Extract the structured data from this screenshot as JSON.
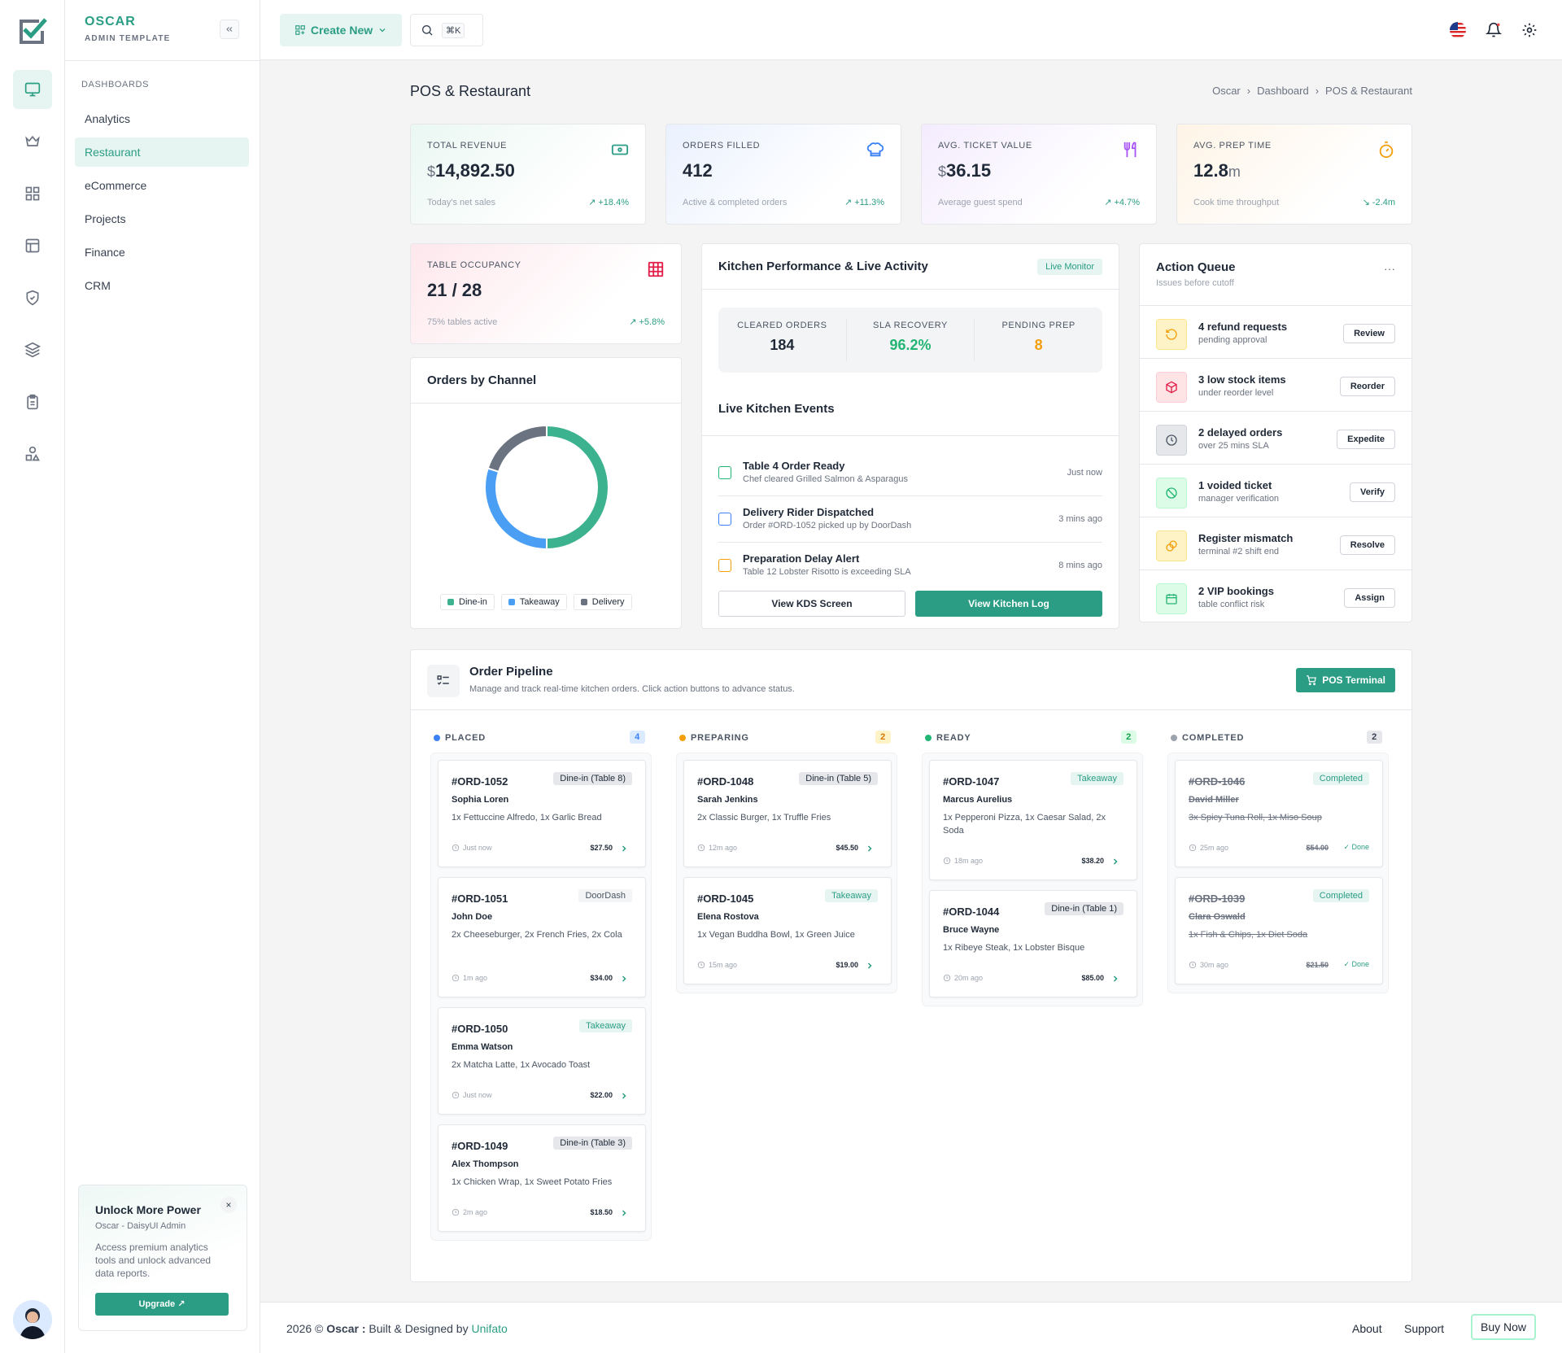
{
  "brand": {
    "name": "OSCAR",
    "tagline": "ADMIN TEMPLATE"
  },
  "rail": {
    "icons": [
      "monitor-icon",
      "crown-icon",
      "grid-icon",
      "layout-icon",
      "shield-icon",
      "layers-icon",
      "clipboard-icon",
      "shapes-icon"
    ]
  },
  "sidebar": {
    "section": "DASHBOARDS",
    "items": [
      {
        "label": "Analytics"
      },
      {
        "label": "Restaurant"
      },
      {
        "label": "eCommerce"
      },
      {
        "label": "Projects"
      },
      {
        "label": "Finance"
      },
      {
        "label": "CRM"
      }
    ]
  },
  "promo": {
    "title": "Unlock More Power",
    "subtitle": "Oscar - DaisyUI Admin",
    "desc": "Access premium analytics tools and unlock advanced data reports.",
    "button": "Upgrade",
    "close": "×"
  },
  "topbar": {
    "create_new": "Create New",
    "shortcut": "⌘K"
  },
  "page": {
    "title": "POS & Restaurant",
    "breadcrumb": [
      "Oscar",
      "Dashboard",
      "POS & Restaurant"
    ]
  },
  "stats": [
    {
      "label": "TOTAL REVENUE",
      "prefix": "$",
      "value": "14,892.50",
      "suffix": "",
      "sub": "Today's net sales",
      "trend": "+18.4%",
      "color": "#2a9d84"
    },
    {
      "label": "ORDERS FILLED",
      "prefix": "",
      "value": "412",
      "suffix": "",
      "sub": "Active & completed orders",
      "trend": "+11.3%",
      "color": "#3b82f6"
    },
    {
      "label": "AVG. TICKET VALUE",
      "prefix": "$",
      "value": "36.15",
      "suffix": "",
      "sub": "Average guest spend",
      "trend": "+4.7%",
      "color": "#a855f7"
    },
    {
      "label": "AVG. PREP TIME",
      "prefix": "",
      "value": "12.8",
      "suffix": "m",
      "sub": "Cook time throughput",
      "trend": "-2.4m",
      "color": "#f59e0b"
    },
    {
      "label": "TABLE OCCUPANCY",
      "prefix": "",
      "value": "21 / 28",
      "suffix": "",
      "sub": "75% tables active",
      "trend": "+5.8%",
      "color": "#e11d48"
    }
  ],
  "channels": {
    "title": "Orders by Channel",
    "legend": [
      "Dine-in",
      "Takeaway",
      "Delivery"
    ]
  },
  "chart_data": {
    "type": "pie",
    "title": "Orders by Channel",
    "categories": [
      "Dine-in",
      "Takeaway",
      "Delivery"
    ],
    "values": [
      50,
      30,
      20
    ],
    "colors": [
      "#3db28f",
      "#4a9ff5",
      "#6b7280"
    ],
    "legend": "bottom"
  },
  "kitchen": {
    "title": "Kitchen Performance & Live Activity",
    "badge": "Live Monitor",
    "stats": [
      {
        "label": "CLEARED ORDERS",
        "value": "184",
        "color": "#1f2937"
      },
      {
        "label": "SLA RECOVERY",
        "value": "96.2%",
        "color": "#22b573"
      },
      {
        "label": "PENDING PREP",
        "value": "8",
        "color": "#f59e0b"
      }
    ],
    "events_title": "Live Kitchen Events",
    "events": [
      {
        "title": "Table 4 Order Ready",
        "sub": "Chef cleared Grilled Salmon & Asparagus",
        "time": "Just now",
        "color": "#22b573"
      },
      {
        "title": "Delivery Rider Dispatched",
        "sub": "Order #ORD-1052 picked up by DoorDash",
        "time": "3 mins ago",
        "color": "#3b82f6"
      },
      {
        "title": "Preparation Delay Alert",
        "sub": "Table 12 Lobster Risotto is exceeding SLA",
        "time": "8 mins ago",
        "color": "#f59e0b"
      }
    ],
    "btn_kds": "View KDS Screen",
    "btn_log": "View Kitchen Log"
  },
  "actions": {
    "title": "Action Queue",
    "sub": "Issues before cutoff",
    "more": "···",
    "items": [
      {
        "title": "4 refund requests",
        "sub": "pending approval",
        "button": "Review",
        "color": "#f59e0b",
        "bg": "#fef3c7",
        "icon": "refund-icon"
      },
      {
        "title": "3 low stock items",
        "sub": "under reorder level",
        "button": "Reorder",
        "color": "#e11d48",
        "bg": "#ffe4e6",
        "icon": "box-icon"
      },
      {
        "title": "2 delayed orders",
        "sub": "over 25 mins SLA",
        "button": "Expedite",
        "color": "#4b5563",
        "bg": "#e5e7eb",
        "icon": "clock-icon"
      },
      {
        "title": "1 voided ticket",
        "sub": "manager verification",
        "button": "Verify",
        "color": "#22b573",
        "bg": "#dcfce7",
        "icon": "ban-icon"
      },
      {
        "title": "Register mismatch",
        "sub": "terminal #2 shift end",
        "button": "Resolve",
        "color": "#f59e0b",
        "bg": "#fef3c7",
        "icon": "coins-icon"
      },
      {
        "title": "2 VIP bookings",
        "sub": "table conflict risk",
        "button": "Assign",
        "color": "#22b573",
        "bg": "#dcfce7",
        "icon": "calendar-icon"
      }
    ]
  },
  "pipeline": {
    "title": "Order Pipeline",
    "sub": "Manage and track real-time kitchen orders. Click action buttons to advance status.",
    "button": "POS Terminal",
    "columns": [
      {
        "name": "PLACED",
        "count": "4",
        "dot": "#3b82f6",
        "cbg": "#dbeafe",
        "cfg": "#3b82f6",
        "orders": [
          {
            "id": "#ORD-1052",
            "tag": "Dine-in (Table 8)",
            "tagType": "gray",
            "name": "Sophia Loren",
            "items": "1x Fettuccine Alfredo, 1x Garlic Bread",
            "time": "Just now",
            "price": "$27.50"
          },
          {
            "id": "#ORD-1051",
            "tag": "DoorDash",
            "tagType": "light",
            "name": "John Doe",
            "items": "2x Cheeseburger, 2x French Fries, 2x Cola",
            "time": "1m ago",
            "price": "$34.00"
          },
          {
            "id": "#ORD-1050",
            "tag": "Takeaway",
            "tagType": "green",
            "name": "Emma Watson",
            "items": "2x Matcha Latte, 1x Avocado Toast",
            "time": "Just now",
            "price": "$22.00"
          },
          {
            "id": "#ORD-1049",
            "tag": "Dine-in (Table 3)",
            "tagType": "gray",
            "name": "Alex Thompson",
            "items": "1x Chicken Wrap, 1x Sweet Potato Fries",
            "time": "2m ago",
            "price": "$18.50"
          }
        ]
      },
      {
        "name": "PREPARING",
        "count": "2",
        "dot": "#f59e0b",
        "cbg": "#fef3c7",
        "cfg": "#d97706",
        "orders": [
          {
            "id": "#ORD-1048",
            "tag": "Dine-in (Table 5)",
            "tagType": "gray",
            "name": "Sarah Jenkins",
            "items": "2x Classic Burger, 1x Truffle Fries",
            "time": "12m ago",
            "price": "$45.50"
          },
          {
            "id": "#ORD-1045",
            "tag": "Takeaway",
            "tagType": "green",
            "name": "Elena Rostova",
            "items": "1x Vegan Buddha Bowl, 1x Green Juice",
            "time": "15m ago",
            "price": "$19.00"
          }
        ]
      },
      {
        "name": "READY",
        "count": "2",
        "dot": "#22b573",
        "cbg": "#dcfce7",
        "cfg": "#16a34a",
        "orders": [
          {
            "id": "#ORD-1047",
            "tag": "Takeaway",
            "tagType": "green",
            "name": "Marcus Aurelius",
            "items": "1x Pepperoni Pizza, 1x Caesar Salad, 2x Soda",
            "time": "18m ago",
            "price": "$38.20"
          },
          {
            "id": "#ORD-1044",
            "tag": "Dine-in (Table 1)",
            "tagType": "gray",
            "name": "Bruce Wayne",
            "items": "1x Ribeye Steak, 1x Lobster Bisque",
            "time": "20m ago",
            "price": "$85.00"
          }
        ]
      },
      {
        "name": "COMPLETED",
        "count": "2",
        "dot": "#9ca3af",
        "cbg": "#e5e7eb",
        "cfg": "#374151",
        "orders": [
          {
            "id": "#ORD-1046",
            "tag": "Completed",
            "tagType": "green",
            "name": "David Miller",
            "items": "3x Spicy Tuna Roll, 1x Miso Soup",
            "time": "25m ago",
            "price": "$54.00",
            "done": "Done"
          },
          {
            "id": "#ORD-1039",
            "tag": "Completed",
            "tagType": "green",
            "name": "Clara Oswald",
            "items": "1x Fish & Chips, 1x Diet Soda",
            "time": "30m ago",
            "price": "$21.50",
            "done": "Done"
          }
        ]
      }
    ]
  },
  "footer": {
    "year": "2026 ©",
    "brand": "Oscar :",
    "built": "Built & Designed by",
    "company": "Unifato",
    "links": [
      "About",
      "Support"
    ],
    "buy": "Buy Now"
  }
}
